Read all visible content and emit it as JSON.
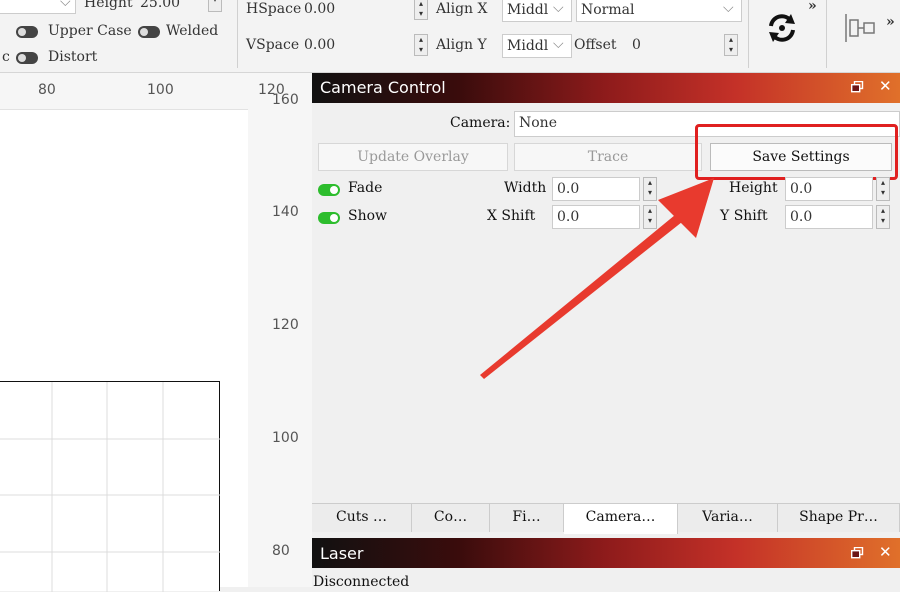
{
  "toolbar": {
    "height_label": "Height",
    "height_value": "25.00",
    "upper_case": "Upper Case",
    "welded": "Welded",
    "distort": "Distort",
    "left_fragment": "c",
    "hspace_label": "HSpace",
    "hspace_value": "0.00",
    "vspace_label": "VSpace",
    "vspace_value": "0.00",
    "align_x_label": "Align X",
    "align_x_value": "Middl",
    "align_y_label": "Align Y",
    "align_y_value": "Middl",
    "mode_value": "Normal",
    "offset_label": "Offset",
    "offset_value": "0",
    "more_glyph": "»"
  },
  "ruler": {
    "top_ticks": [
      "80",
      "100",
      "120"
    ],
    "right_ticks": [
      "160",
      "140",
      "120",
      "100",
      "80"
    ]
  },
  "camera_panel": {
    "title": "Camera Control",
    "camera_label": "Camera:",
    "camera_value": "None",
    "update_overlay": "Update Overlay",
    "trace": "Trace",
    "save_settings": "Save Settings",
    "fade": "Fade",
    "show": "Show",
    "width_label": "Width",
    "width_value": "0.0",
    "height_label": "Height",
    "height_value": "0.0",
    "x_shift_label": "X Shift",
    "x_shift_value": "0.0",
    "y_shift_label": "Y Shift",
    "y_shift_value": "0.0"
  },
  "tabs": [
    {
      "label": "Cuts …"
    },
    {
      "label": "Co…"
    },
    {
      "label": "Fi…"
    },
    {
      "label": "Camera…"
    },
    {
      "label": "Varia…"
    },
    {
      "label": "Shape Pr…"
    }
  ],
  "laser_panel": {
    "title": "Laser",
    "status": "Disconnected"
  },
  "colors": {
    "highlight": "#e02020",
    "toggle_on": "#2dbd2d"
  }
}
